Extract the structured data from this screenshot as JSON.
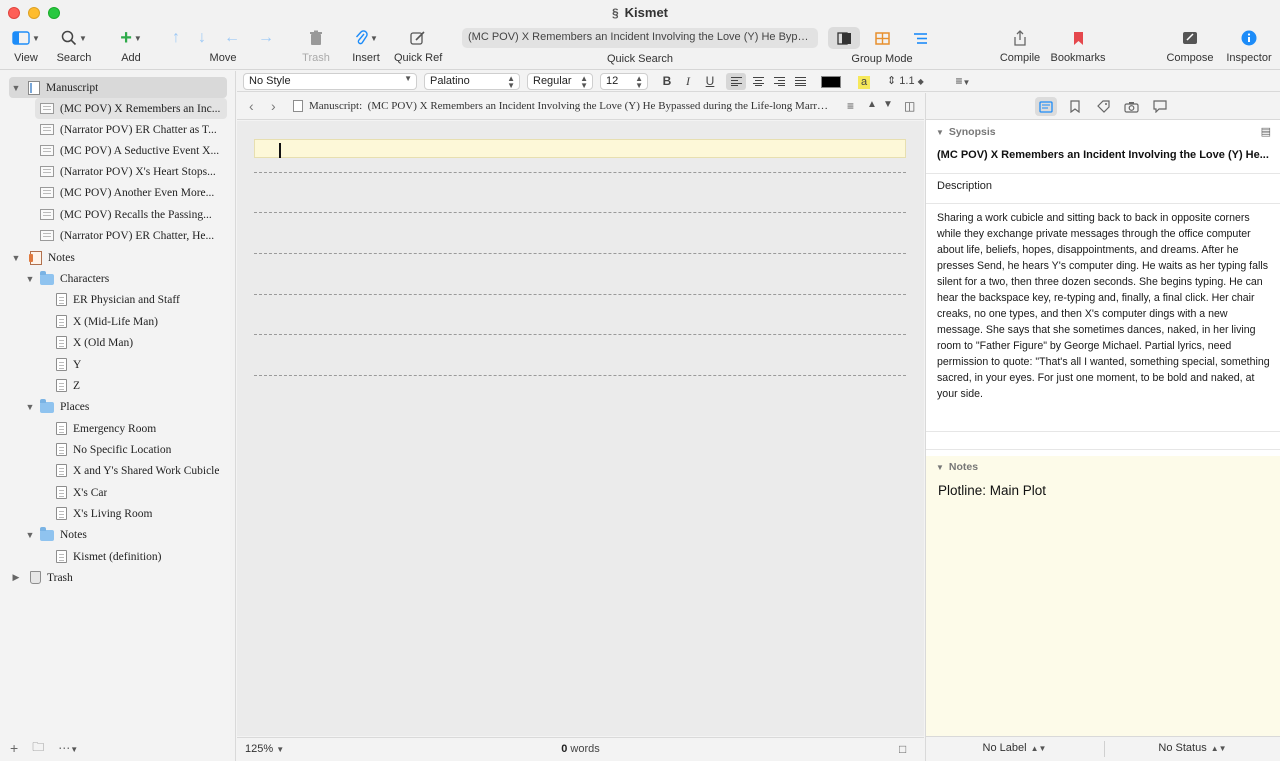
{
  "window": {
    "title": "Kismet"
  },
  "toolbar": {
    "view": "View",
    "search": "Search",
    "add": "Add",
    "move": "Move",
    "trash": "Trash",
    "insert": "Insert",
    "quick_ref": "Quick Ref",
    "quick_search_value": "(MC POV) X Remembers an Incident Involving the Love (Y) He Bypassed du...",
    "quick_search_label": "Quick Search",
    "group_mode": "Group Mode",
    "compile": "Compile",
    "bookmarks": "Bookmarks",
    "compose": "Compose",
    "inspector": "Inspector"
  },
  "binder": {
    "manuscript": "Manuscript",
    "scenes": [
      "(MC POV) X Remembers an Inc...",
      "(Narrator POV) ER Chatter as T...",
      "(MC POV) A Seductive Event X...",
      "(Narrator POV) X's Heart Stops...",
      "(MC POV) Another Even More...",
      "(MC POV) Recalls the Passing...",
      "(Narrator POV) ER Chatter, He..."
    ],
    "notes": "Notes",
    "characters": "Characters",
    "character_items": [
      "ER Physician and Staff",
      "X (Mid-Life Man)",
      "X (Old Man)",
      "Y",
      "Z"
    ],
    "places": "Places",
    "place_items": [
      "Emergency Room",
      "No Specific Location",
      "X and Y's Shared Work Cubicle",
      "X's Car",
      "X's Living Room"
    ],
    "notes_folder": "Notes",
    "notes_items": [
      "Kismet (definition)"
    ],
    "trash": "Trash"
  },
  "formatbar": {
    "style": "No Style",
    "font": "Palatino",
    "weight": "Regular",
    "size": "12",
    "bold": "B",
    "italic": "I",
    "underline": "U",
    "highlight": "a",
    "line_spacing": "1.1"
  },
  "editor": {
    "breadcrumb_prefix": "Manuscript:",
    "breadcrumb": "(MC POV) X Remembers an Incident Involving the Love (Y) He Bypassed during the Life-long Marriage to Som...",
    "zoom": "125%",
    "word_count": "0",
    "words_label": "words"
  },
  "inspector": {
    "synopsis_header": "Synopsis",
    "synopsis_title": "(MC POV) X Remembers an Incident Involving the Love (Y) He...",
    "description_label": "Description",
    "description": "Sharing a work cubicle and sitting back to back in opposite corners while they exchange private messages through the office computer about life, beliefs, hopes, disappointments, and dreams. After he presses Send, he hears Y's computer ding. He waits as her typing falls silent for a two, then three dozen seconds. She begins typing. He can hear the backspace key, re-typing and, finally, a final click. Her chair creaks, no one types, and then X's computer dings with a new message. She says that she sometimes dances, naked, in her living room to \"Father Figure\" by George Michael. Partial lyrics, need permission to quote: \"That's all I wanted, something special, something sacred, in your eyes. For just one moment, to be bold and naked, at your side.",
    "notes_header": "Notes",
    "notes_text": "Plotline: Main Plot",
    "label": "No Label",
    "status": "No Status"
  },
  "colors": {
    "accent": "#1d8cf8",
    "bookmark": "#e5484d",
    "highlight_yellow": "#fdf8d8"
  }
}
